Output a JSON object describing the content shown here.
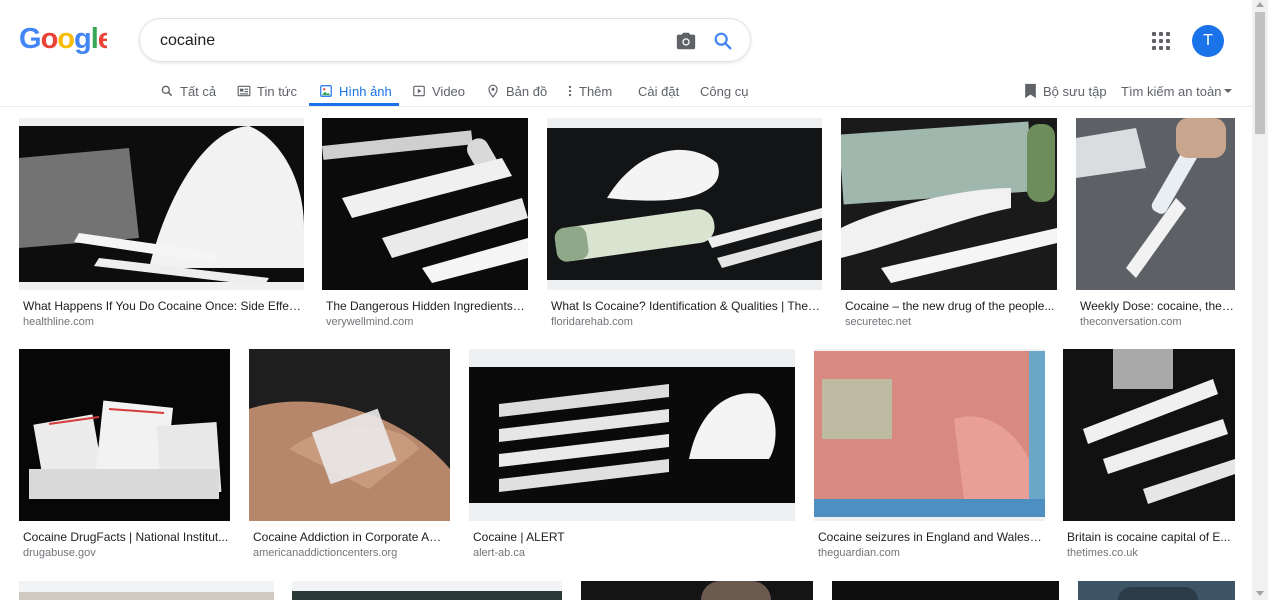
{
  "search": {
    "query": "cocaine"
  },
  "account": {
    "initial": "T"
  },
  "nav": {
    "all": "Tất cả",
    "news": "Tin tức",
    "images": "Hình ảnh",
    "video": "Video",
    "maps": "Bản đồ",
    "more": "Thêm",
    "settings": "Cài đặt",
    "tools": "Công cụ",
    "collections": "Bộ sưu tập",
    "safesearch": "Tìm kiếm an toàn"
  },
  "results": [
    {
      "title": "What Happens If You Do Cocaine Once: Side Effect...",
      "source": "healthline.com"
    },
    {
      "title": "The Dangerous Hidden Ingredients i...",
      "source": "verywellmind.com"
    },
    {
      "title": "What Is Cocaine? Identification & Qualities | The ...",
      "source": "floridarehab.com"
    },
    {
      "title": "Cocaine – the new drug of the people...",
      "source": "securetec.net"
    },
    {
      "title": "Weekly Dose: cocaine, the ...",
      "source": "theconversation.com"
    },
    {
      "title": "Cocaine DrugFacts | National Institut...",
      "source": "drugabuse.gov"
    },
    {
      "title": "Cocaine Addiction in Corporate Am...",
      "source": "americanaddictioncenters.org"
    },
    {
      "title": "Cocaine | ALERT",
      "source": "alert-ab.ca"
    },
    {
      "title": "Cocaine seizures in England and Wales a...",
      "source": "theguardian.com"
    },
    {
      "title": "Britain is cocaine capital of E...",
      "source": "thetimes.co.uk"
    }
  ],
  "colors": {
    "accent": "#1a73e8",
    "muted": "#5f6368",
    "source": "#70757a"
  }
}
